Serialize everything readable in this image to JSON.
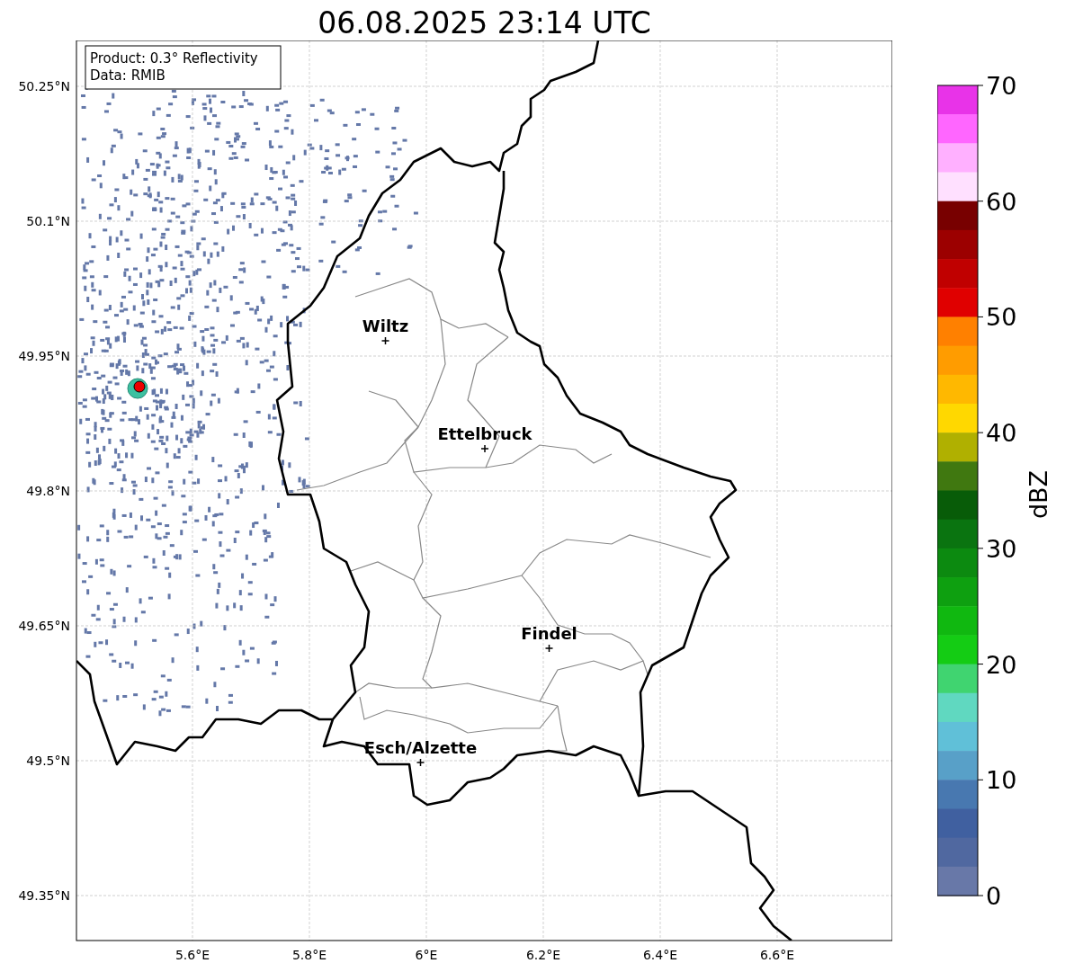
{
  "title": "06.08.2025 23:14 UTC",
  "info_box": [
    "Product: 0.3° Reflectivity",
    "Data: RMIB"
  ],
  "lat_ticks": [
    "50.25°N",
    "50.1°N",
    "49.95°N",
    "49.8°N",
    "49.65°N",
    "49.5°N",
    "49.35°N"
  ],
  "lon_ticks": [
    "5.6°E",
    "5.8°E",
    "6°E",
    "6.2°E",
    "6.4°E",
    "6.6°E"
  ],
  "cities": [
    {
      "name": "Wiltz"
    },
    {
      "name": "Ettelbruck"
    },
    {
      "name": "Findel"
    },
    {
      "name": "Esch/Alzette"
    }
  ],
  "colorbar": {
    "label": "dBZ",
    "ticks": [
      "70",
      "60",
      "50",
      "40",
      "30",
      "20",
      "10",
      "0"
    ],
    "colors": [
      {
        "color": "#e833e8"
      },
      {
        "color": "#ff66ff"
      },
      {
        "color": "#ffb0ff"
      },
      {
        "color": "#ffe0ff"
      },
      {
        "color": "#780000"
      },
      {
        "color": "#9c0000"
      },
      {
        "color": "#c00000"
      },
      {
        "color": "#e00000"
      },
      {
        "color": "#ff8000"
      },
      {
        "color": "#ff9c00"
      },
      {
        "color": "#ffb800"
      },
      {
        "color": "#ffd800"
      },
      {
        "color": "#b0b000"
      },
      {
        "color": "#407810"
      },
      {
        "color": "#085c08"
      },
      {
        "color": "#0a7410"
      },
      {
        "color": "#0c8a10"
      },
      {
        "color": "#0ea010"
      },
      {
        "color": "#10b810"
      },
      {
        "color": "#14cc14"
      },
      {
        "color": "#40d470"
      },
      {
        "color": "#60d8c0"
      },
      {
        "color": "#60c0d8"
      },
      {
        "color": "#58a0c8"
      },
      {
        "color": "#4878b0"
      },
      {
        "color": "#4060a0"
      },
      {
        "color": "#5068a0"
      },
      {
        "color": "#6878a8"
      }
    ]
  }
}
